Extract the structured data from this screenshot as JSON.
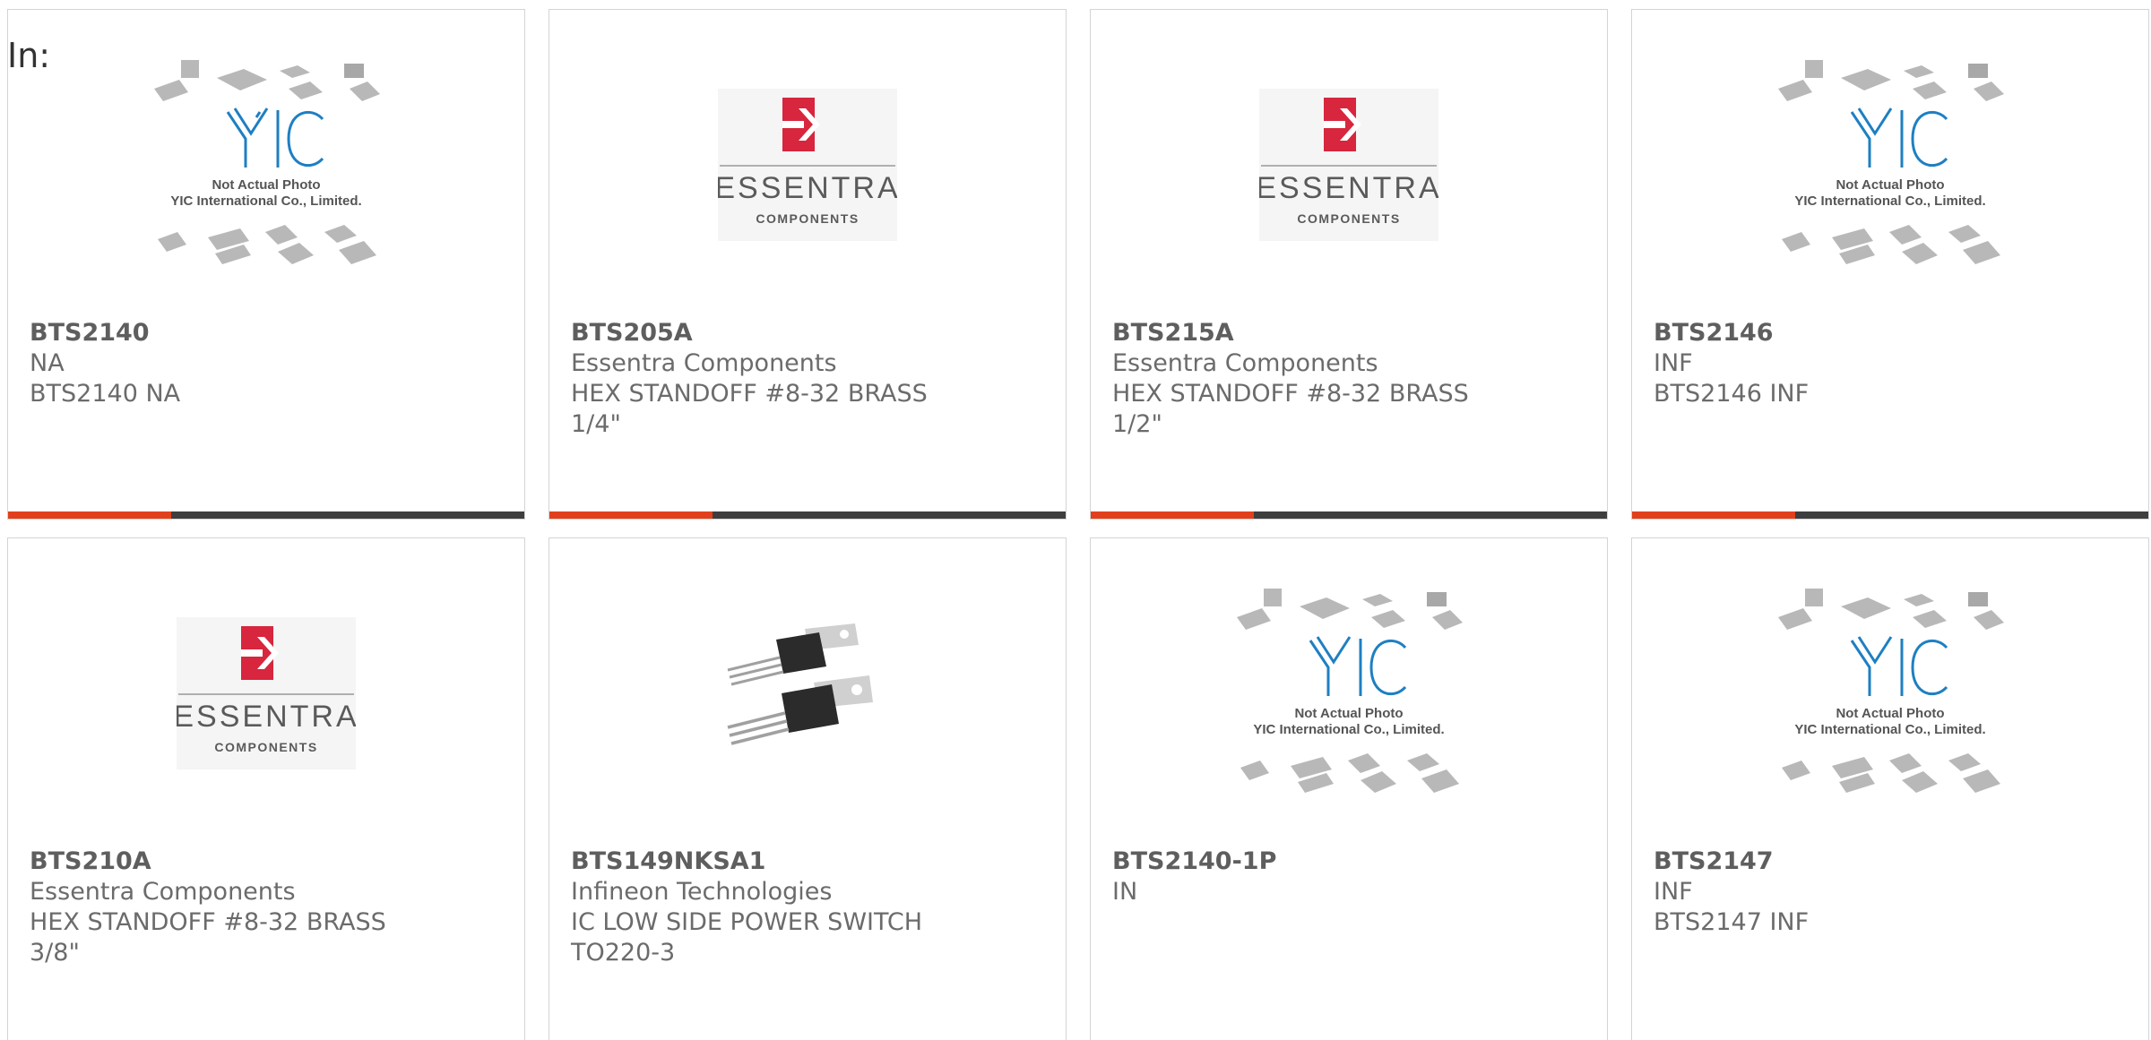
{
  "heading": "In:",
  "products": [
    {
      "pn": "BTS2140",
      "maker": "NA",
      "desc1": "BTS2140 NA",
      "desc2": "",
      "image": "yic-not-actual-photo",
      "img_line1": "Not Actual Photo",
      "img_line2": "YIC International Co., Limited."
    },
    {
      "pn": "BTS205A",
      "maker": "Essentra Components",
      "desc1": "HEX STANDOFF #8-32 BRASS",
      "desc2": "1/4\"",
      "image": "essentra-logo",
      "img_line1": "ESSENTRA",
      "img_line2": "COMPONENTS"
    },
    {
      "pn": "BTS215A",
      "maker": "Essentra Components",
      "desc1": "HEX STANDOFF #8-32 BRASS",
      "desc2": "1/2\"",
      "image": "essentra-logo",
      "img_line1": "ESSENTRA",
      "img_line2": "COMPONENTS"
    },
    {
      "pn": "BTS2146",
      "maker": "INF",
      "desc1": "BTS2146 INF",
      "desc2": "",
      "image": "yic-not-actual-photo",
      "img_line1": "Not Actual Photo",
      "img_line2": "YIC International Co., Limited."
    },
    {
      "pn": "BTS210A",
      "maker": "Essentra Components",
      "desc1": "HEX STANDOFF #8-32 BRASS",
      "desc2": "3/8\"",
      "image": "essentra-logo",
      "img_line1": "ESSENTRA",
      "img_line2": "COMPONENTS"
    },
    {
      "pn": "BTS149NKSA1",
      "maker": "Infineon Technologies",
      "desc1": "IC LOW SIDE POWER SWITCH",
      "desc2": "TO220-3",
      "image": "to220-package-photo",
      "img_line1": "",
      "img_line2": ""
    },
    {
      "pn": "BTS2140-1P",
      "maker": "IN",
      "desc1": "",
      "desc2": "",
      "image": "yic-not-actual-photo",
      "img_line1": "Not Actual Photo",
      "img_line2": "YIC International Co., Limited."
    },
    {
      "pn": "BTS2147",
      "maker": "INF",
      "desc1": "BTS2147 INF",
      "desc2": "",
      "image": "yic-not-actual-photo",
      "img_line1": "Not Actual Photo",
      "img_line2": "YIC International Co., Limited."
    }
  ],
  "colors": {
    "accent": "#e2401c",
    "bar": "#3e3e3e",
    "essentra_red": "#d7263d",
    "yic_blue": "#1e7fc2"
  }
}
